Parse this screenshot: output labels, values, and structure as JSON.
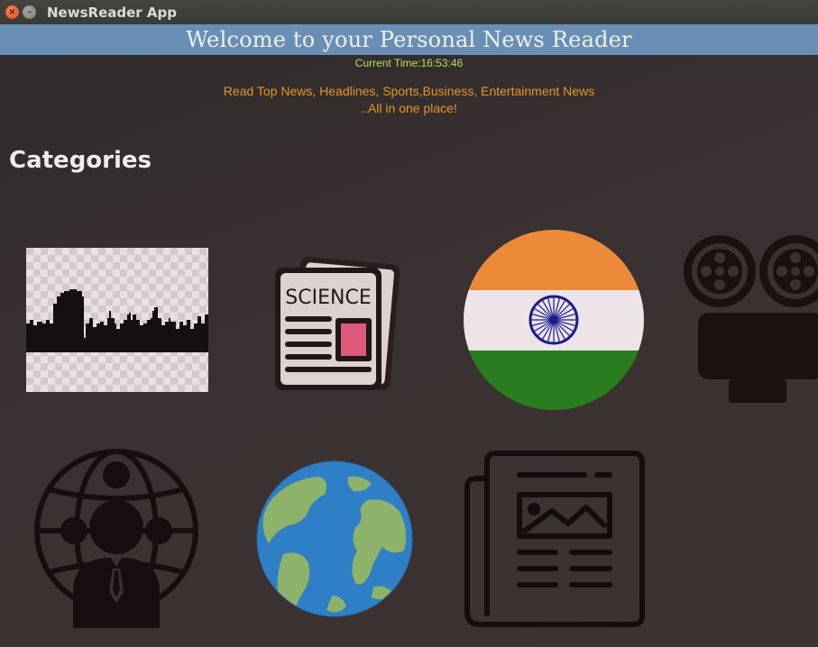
{
  "window": {
    "title": "NewsReader App"
  },
  "header": {
    "welcome": "Welcome to your Personal News Reader",
    "time_label": "Current Time:",
    "time_value": "16:53:46",
    "tagline_line1": "Read Top News, Headlines, Sports,Business, Entertainment  News",
    "tagline_line2": "..All in one place!"
  },
  "categories": {
    "heading": "Categories",
    "items": [
      {
        "icon": "city-skyline-icon"
      },
      {
        "icon": "science-newspaper-icon",
        "text": "SCIENCE"
      },
      {
        "icon": "india-flag-icon"
      },
      {
        "icon": "film-camera-icon"
      },
      {
        "icon": "business-person-globe-icon"
      },
      {
        "icon": "world-globe-icon"
      },
      {
        "icon": "newspaper-icon"
      }
    ]
  },
  "colors": {
    "welcome_bar": "#6a8fb5",
    "time_text": "#b7e05b",
    "tagline_text": "#e79520",
    "flag_saffron": "#ec8a3a",
    "flag_white": "#ece4e6",
    "flag_green": "#2a7d1e",
    "chakra": "#1c1a8c"
  }
}
